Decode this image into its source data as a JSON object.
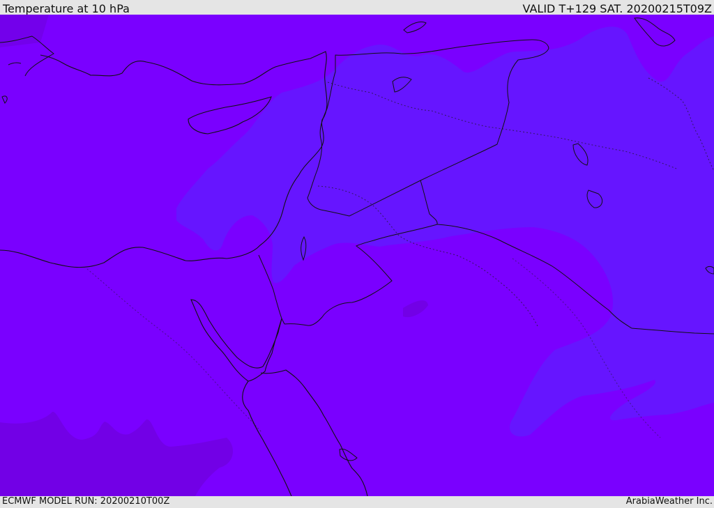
{
  "header": {
    "title": "Temperature at 10 hPa",
    "valid_time": "VALID T+129 SAT. 20200215T09Z"
  },
  "footer": {
    "model_run": "ECMWF MODEL RUN: 20200210T00Z",
    "credit": "ArabiaWeather Inc."
  },
  "map": {
    "colors": {
      "base_fill": "#7a00ff",
      "cooler_fill": "#6615ff",
      "warmer_fill": "#7200e6",
      "coastline": "#111111",
      "border": "#111111"
    }
  }
}
